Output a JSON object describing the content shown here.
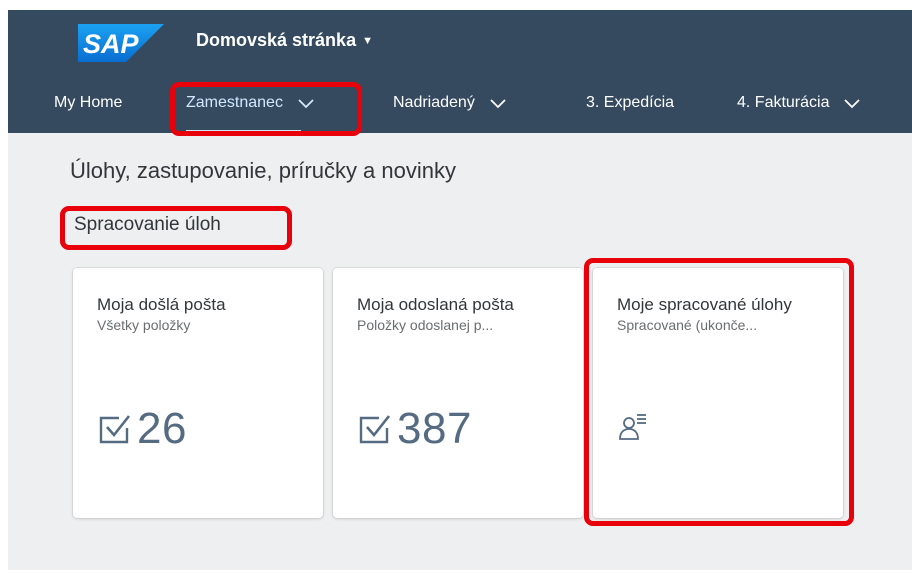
{
  "shell": {
    "logo_text": "SAP",
    "title": "Domovská stránka",
    "title_caret": "▼",
    "brand_color": "#354a5f",
    "logo_color": "#0a6ed1"
  },
  "tabs": [
    {
      "label": "My Home",
      "has_dropdown": false,
      "active": false
    },
    {
      "label": "Zamestnanec",
      "has_dropdown": true,
      "active": true
    },
    {
      "label": "Nadriadený",
      "has_dropdown": true,
      "active": false
    },
    {
      "label": "3. Expedícia",
      "has_dropdown": false,
      "active": false
    },
    {
      "label": "4. Fakturácia",
      "has_dropdown": true,
      "active": false
    }
  ],
  "main": {
    "heading": "Úlohy, zastupovanie, príručky a novinky",
    "group_title": "Spracovanie úloh"
  },
  "tiles": [
    {
      "title": "Moja došlá pošta",
      "subtitle": "Všetky položky",
      "value": "26",
      "icon": "checkbox-icon"
    },
    {
      "title": "Moja odoslaná pošta",
      "subtitle": "Položky odoslanej p...",
      "value": "387",
      "icon": "checkbox-icon"
    },
    {
      "title": "Moje spracované úlohy",
      "subtitle": "Spracované (ukonče...",
      "value": "",
      "icon": "user-list-icon"
    }
  ],
  "annotations": {
    "highlight_color": "#e8000b"
  }
}
